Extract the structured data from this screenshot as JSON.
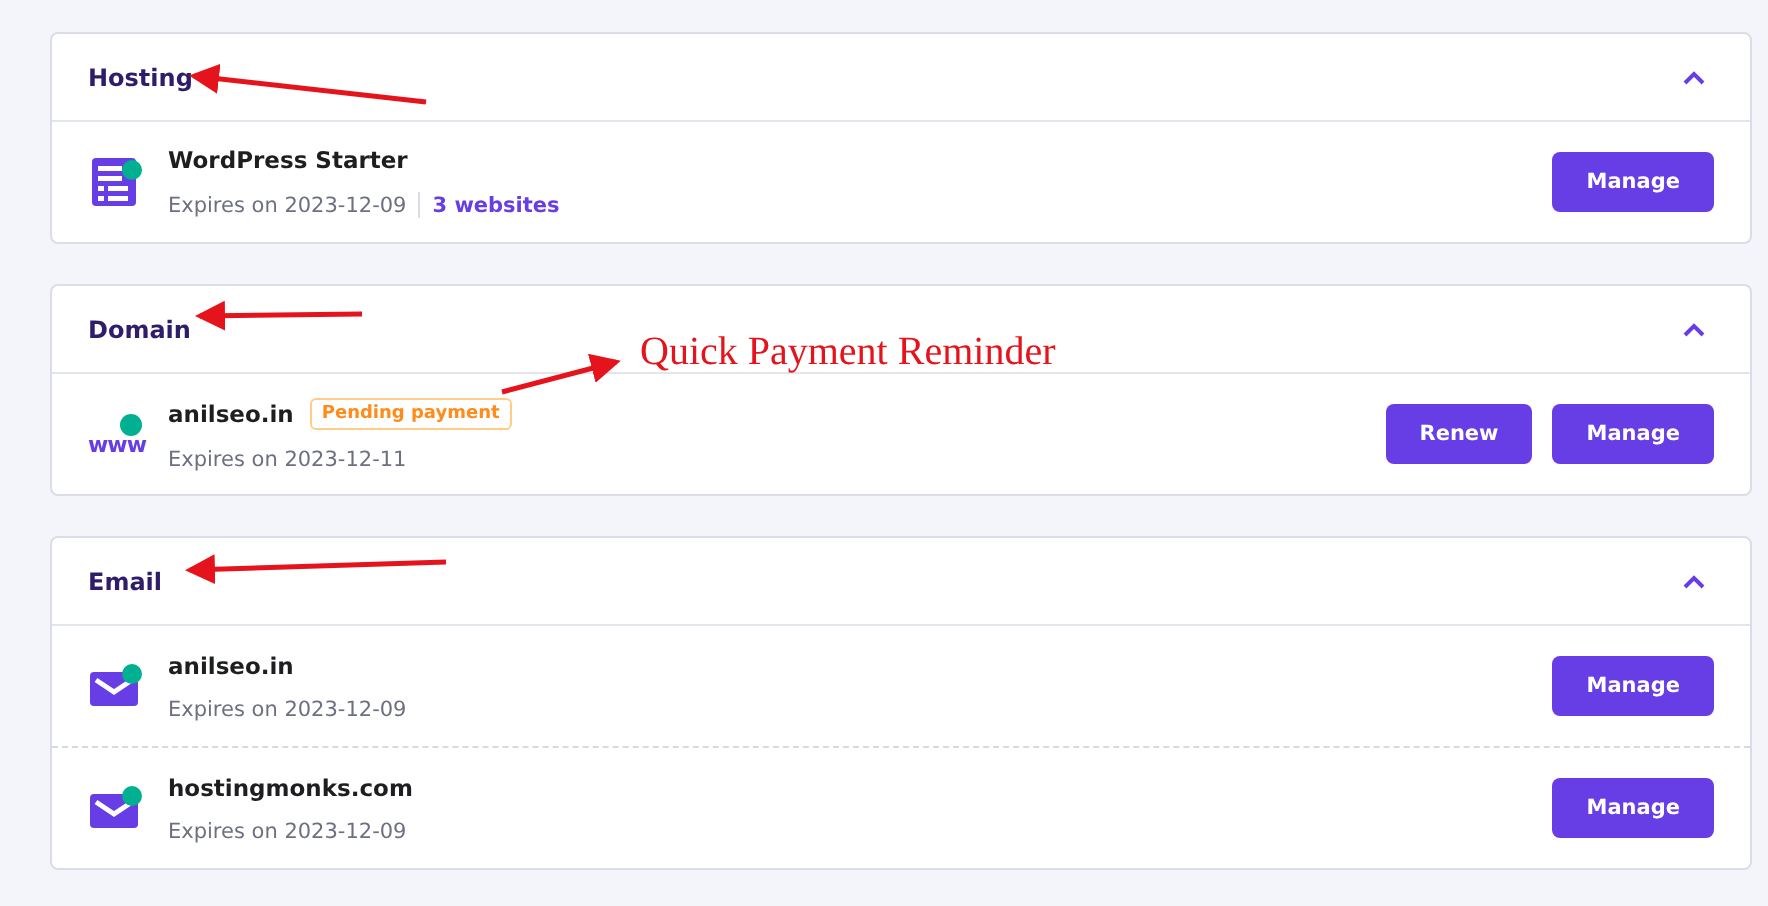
{
  "sections": [
    {
      "title": "Hosting",
      "expanded": true,
      "items": [
        {
          "kind": "hosting",
          "name": "WordPress Starter",
          "expires": "Expires on 2023-12-09",
          "link": "3 websites",
          "buttons": [
            "Manage"
          ]
        }
      ]
    },
    {
      "title": "Domain",
      "expanded": true,
      "items": [
        {
          "kind": "domain",
          "icon_label": "www",
          "name": "anilseo.in",
          "badge": "Pending payment",
          "expires": "Expires on 2023-12-11",
          "buttons": [
            "Renew",
            "Manage"
          ]
        }
      ]
    },
    {
      "title": "Email",
      "expanded": true,
      "items": [
        {
          "kind": "email",
          "name": "anilseo.in",
          "expires": "Expires on 2023-12-09",
          "buttons": [
            "Manage"
          ]
        },
        {
          "kind": "email",
          "name": "hostingmonks.com",
          "expires": "Expires on 2023-12-09",
          "buttons": [
            "Manage"
          ]
        }
      ]
    }
  ],
  "annotation": "Quick Payment Reminder"
}
